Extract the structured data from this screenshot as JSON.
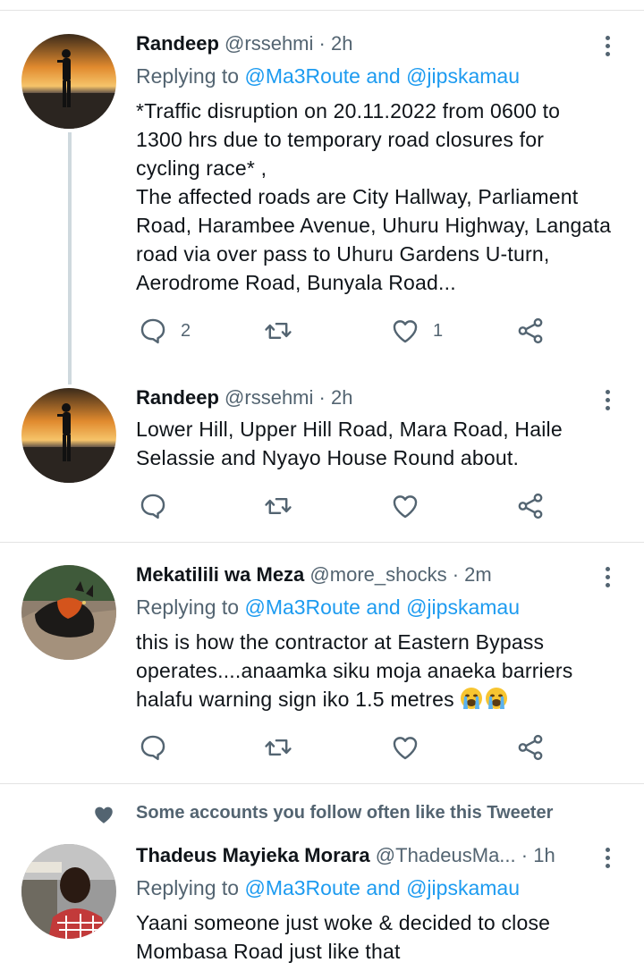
{
  "colors": {
    "link": "#1d9bf0",
    "secondary": "#536471",
    "text": "#0f1419",
    "divider": "#e3e3e3"
  },
  "tweets": [
    {
      "name": "Randeep",
      "handle": "@rssehmi",
      "dot": "·",
      "time": "2h",
      "reply_prefix": "Replying to",
      "reply_mentions": "@Ma3Route and @jipskamau",
      "body_lines": [
        "*Traffic disruption on 20.11.2022 from 0600 to",
        "1300 hrs due to temporary road closures for",
        "cycling race* ,",
        "The affected roads are City Hallway, Parliament",
        "Road, Harambee Avenue, Uhuru Highway, Langata",
        "road via over pass to Uhuru Gardens U-turn,",
        "Aerodrome Road, Bunyala Road..."
      ],
      "replies": "2",
      "retweets": "",
      "likes": "1"
    },
    {
      "name": "Randeep",
      "handle": "@rssehmi",
      "dot": "·",
      "time": "2h",
      "body_lines": [
        "Lower Hill, Upper Hill Road, Mara Road, Haile",
        "Selassie and Nyayo House Round about."
      ],
      "replies": "",
      "retweets": "",
      "likes": ""
    },
    {
      "name": "Mekatilili wa Meza",
      "handle": "@more_shocks",
      "dot": "·",
      "time": "2m",
      "reply_prefix": "Replying to",
      "reply_mentions": "@Ma3Route and @jipskamau",
      "body_lines": [
        "this is how the contractor at Eastern Bypass",
        "operates....anaamka siku moja anaeka barriers",
        "halafu warning sign iko 1.5 metres"
      ],
      "emoji": [
        "loudly-crying-face",
        "loudly-crying-face"
      ],
      "replies": "",
      "retweets": "",
      "likes": ""
    },
    {
      "social_context": "Some accounts you follow often like this Tweeter",
      "name": "Thadeus Mayieka Morara",
      "handle": "@ThadeusMa...",
      "dot": "·",
      "time": "1h",
      "reply_prefix": "Replying to",
      "reply_mentions": "@Ma3Route and @jipskamau",
      "body_lines": [
        "Yaani someone just woke & decided to close",
        "Mombasa Road just like that"
      ]
    }
  ]
}
